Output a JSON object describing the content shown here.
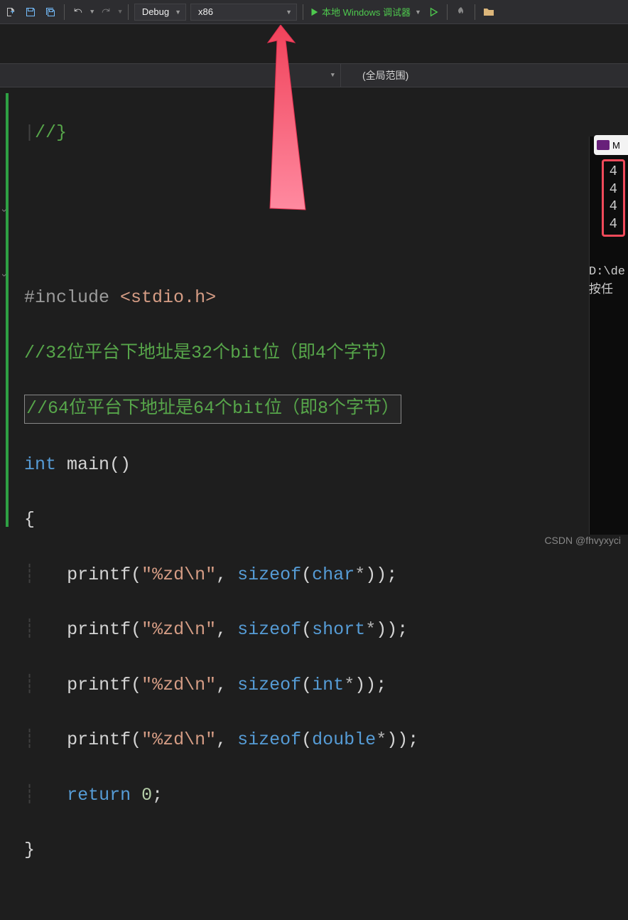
{
  "toolbar": {
    "config_dropdown": "Debug",
    "platform_dropdown": "x86",
    "debug_button": "本地 Windows 调试器"
  },
  "scope_bar": {
    "scope_label": "(全局范围)"
  },
  "code": {
    "l1": "//}",
    "include_kw": "#include",
    "include_header": "<stdio.h>",
    "comment32": "//32位平台下地址是32个bit位（即4个字节）",
    "comment64": "//64位平台下地址是64个bit位（即8个字节）",
    "kw_int": "int",
    "fn_main": "main",
    "fn_printf": "printf",
    "fmt": "\"%zd\\n\"",
    "kw_sizeof": "sizeof",
    "kw_char": "char",
    "kw_short": "short",
    "kw_int2": "int",
    "kw_double": "double",
    "kw_return": "return",
    "zero": "0"
  },
  "output": {
    "tab_label": "M",
    "values": [
      "4",
      "4",
      "4",
      "4"
    ],
    "path": "D:\\de",
    "prompt": "按任"
  },
  "watermark": "CSDN @fhvyxyci"
}
